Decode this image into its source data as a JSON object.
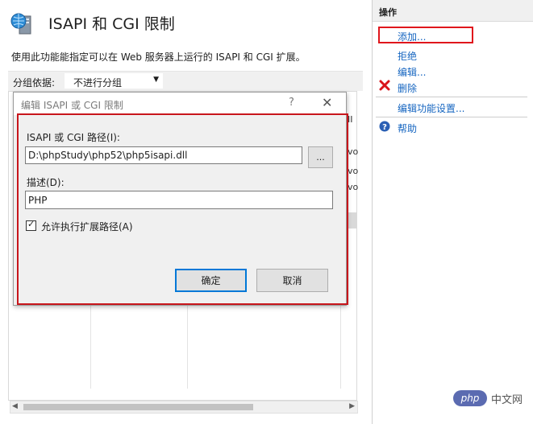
{
  "page": {
    "title": "ISAPI 和 CGI 限制",
    "description": "使用此功能能指定可以在 Web 服务器上运行的 ISAPI 和 CGI 扩展。",
    "group_by_label": "分组依据:",
    "group_by_value": "不进行分组"
  },
  "list_peek": [
    "II",
    "vo",
    "vo",
    "vo"
  ],
  "actions": {
    "title": "操作",
    "items": [
      {
        "label": "添加...",
        "icon": null
      },
      {
        "label": "拒绝",
        "icon": null
      },
      {
        "label": "编辑...",
        "icon": null
      },
      {
        "label": "删除",
        "icon": "delete-icon"
      },
      {
        "label": "编辑功能设置...",
        "icon": null
      },
      {
        "label": "帮助",
        "icon": "help-icon"
      }
    ]
  },
  "dialog": {
    "title": "编辑 ISAPI 或 CGI 限制",
    "help_glyph": "?",
    "close_glyph": "✕",
    "path_label": "ISAPI 或 CGI 路径(I):",
    "path_value": "D:\\phpStudy\\php52\\php5isapi.dll",
    "browse_label": "...",
    "desc_label": "描述(D):",
    "desc_value": "PHP",
    "allow_label": "允许执行扩展路径(A)",
    "allow_checked": true,
    "ok_label": "确定",
    "cancel_label": "取消"
  },
  "colors": {
    "link": "#1565c0",
    "highlight_red": "#c8161c",
    "focus_blue": "#0078d7"
  },
  "watermark": {
    "logo": "php",
    "text": "中文网"
  }
}
